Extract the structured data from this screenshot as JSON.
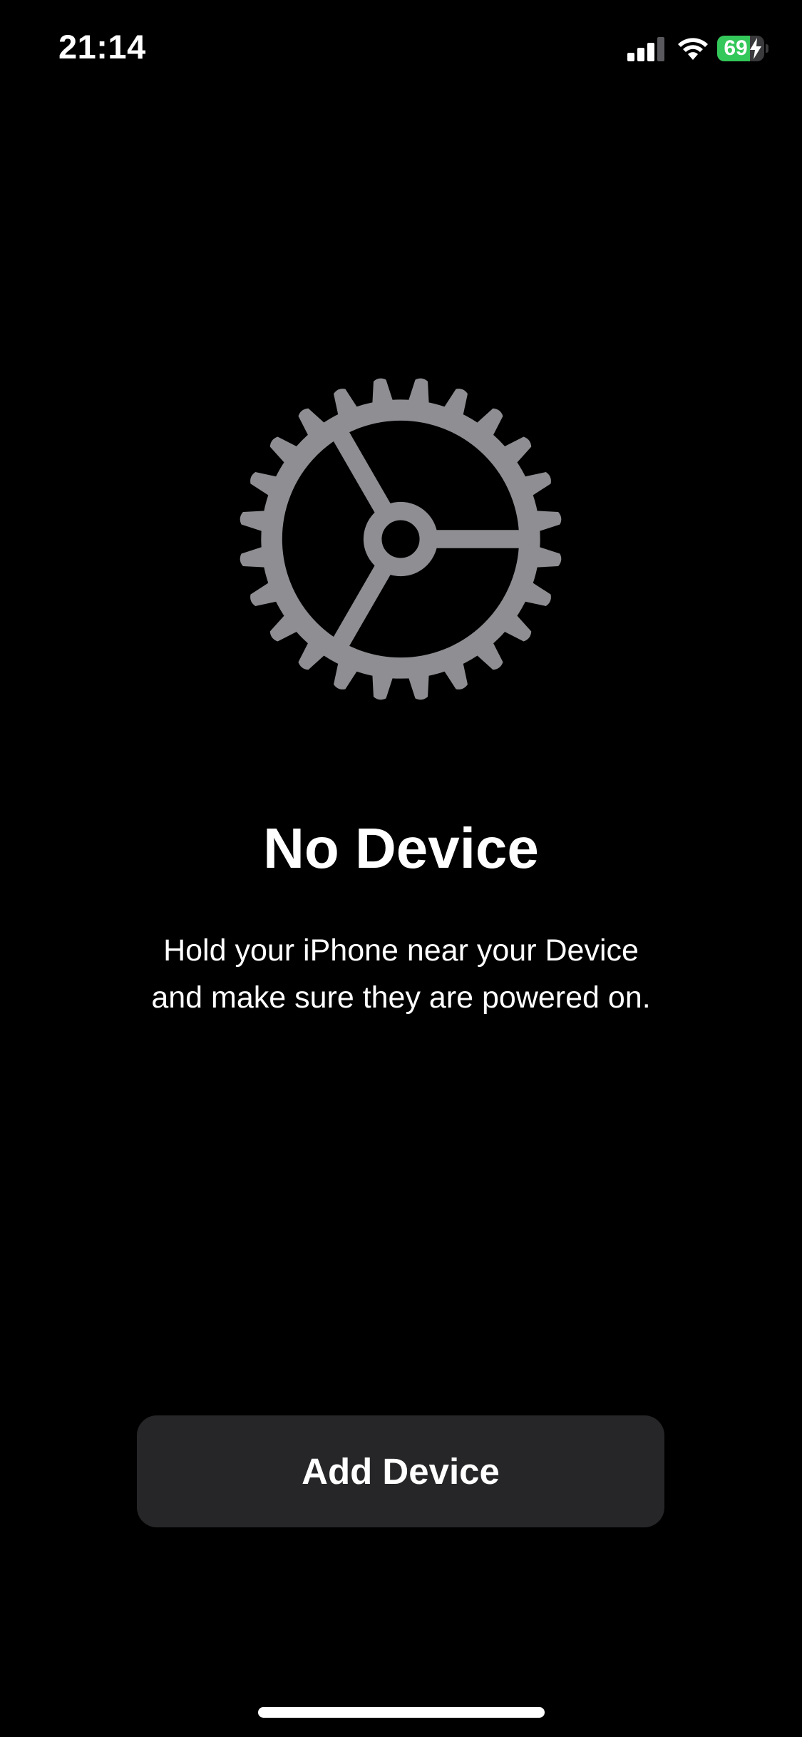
{
  "status_bar": {
    "time": "21:14",
    "battery_percent": "69",
    "battery_level": 0.69,
    "battery_charging": true,
    "battery_color": "#34c759"
  },
  "main": {
    "illustration_icon": "gear-icon",
    "title": "No Device",
    "description": "Hold your iPhone near your Device and make sure they are powered on."
  },
  "actions": {
    "add_device_label": "Add Device"
  },
  "colors": {
    "background": "#000000",
    "icon": "#8e8e93",
    "button_bg": "#262628",
    "text": "#ffffff"
  }
}
